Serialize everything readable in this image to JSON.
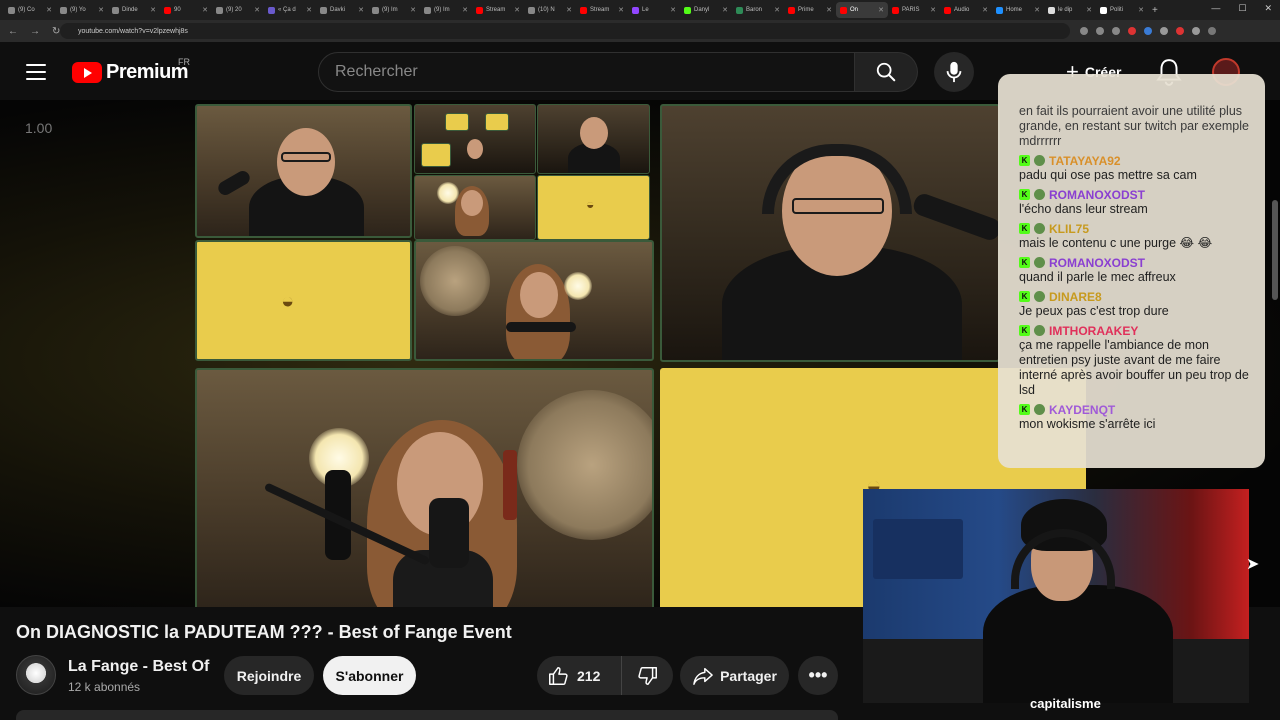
{
  "browser": {
    "url": "youtube.com/watch?v=v2lpzewhj8s",
    "tabs": [
      {
        "label": "(9) Co",
        "color": "#888888"
      },
      {
        "label": "(9) Yo",
        "color": "#888888"
      },
      {
        "label": "Dinde",
        "color": "#888888"
      },
      {
        "label": "90",
        "color": "#ff0000"
      },
      {
        "label": "(9) 20",
        "color": "#888888"
      },
      {
        "label": "« Ça d",
        "color": "#6a5acd"
      },
      {
        "label": "Davki",
        "color": "#888888"
      },
      {
        "label": "(9) Im",
        "color": "#888888"
      },
      {
        "label": "(9) Im",
        "color": "#888888"
      },
      {
        "label": "Stream",
        "color": "#ff0000"
      },
      {
        "label": "(10) N",
        "color": "#888888"
      },
      {
        "label": "Stream",
        "color": "#ff0000"
      },
      {
        "label": "Le",
        "color": "#9146ff"
      },
      {
        "label": "Danyl",
        "color": "#53fc18"
      },
      {
        "label": "Baron",
        "color": "#2e8b57"
      },
      {
        "label": "Prime",
        "color": "#ff0000"
      },
      {
        "label": "On",
        "color": "#ff0000",
        "active": true
      },
      {
        "label": "PARIS",
        "color": "#ff0000"
      },
      {
        "label": "Audio",
        "color": "#ff0000"
      },
      {
        "label": "Home",
        "color": "#1e90ff"
      },
      {
        "label": "le dip",
        "color": "#dddddd"
      },
      {
        "label": "Politi",
        "color": "#ffffff"
      }
    ]
  },
  "header": {
    "logo_text": "Premium",
    "country": "FR",
    "search_placeholder": "Rechercher",
    "create_label": "Créer"
  },
  "player": {
    "speed": "1.00"
  },
  "chat": {
    "first_partial": "en fait ils pourraient avoir une utilité plus grande, en restant sur twitch par exemple mdrrrrrr",
    "messages": [
      {
        "user": "TATAYAYA92",
        "color": "#d9902a",
        "text": "padu qui ose pas mettre sa cam"
      },
      {
        "user": "ROMANOXODST",
        "color": "#8a3fd1",
        "text": "l'écho dans leur stream"
      },
      {
        "user": "KLIL75",
        "color": "#c79a1e",
        "text": "mais le contenu c une purge 😂 😂"
      },
      {
        "user": "ROMANOXODST",
        "color": "#8a3fd1",
        "text": "quand il parle le mec affreux"
      },
      {
        "user": "DINARE8",
        "color": "#c79a1e",
        "text": "Je peux pas c'est trop dure"
      },
      {
        "user": "IMTHORAAKEY",
        "color": "#e0305a",
        "text": "ça me rappelle l'ambiance de mon entretien psy juste avant de me faire interné après avoir bouffer un peu trop de lsd"
      },
      {
        "user": "KAYDENQT",
        "color": "#a05ad8",
        "text": "mon wokisme s'arrête ici"
      }
    ]
  },
  "overlay": {
    "caption_text": "capitalisme"
  },
  "video": {
    "title": "On DIAGNOSTIC la PADUTEAM ??? - Best of Fange Event",
    "channel_name": "La Fange - Best Of",
    "subscribers": "12 k abonnés",
    "join_label": "Rejoindre",
    "subscribe_label": "S'abonner",
    "like_count": "212",
    "share_label": "Partager"
  },
  "colors": {
    "accent": "#ff0000",
    "kick_green": "#53fc18",
    "tile_yellow": "#e9cc4c"
  }
}
